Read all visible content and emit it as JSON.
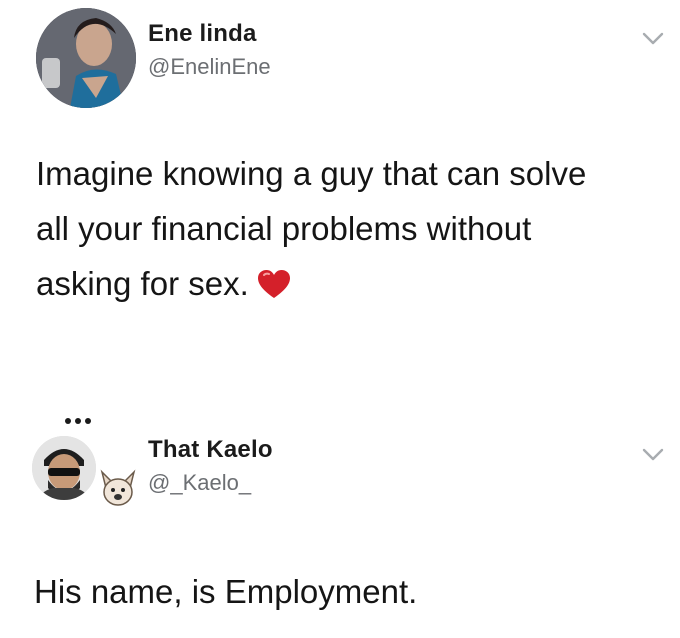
{
  "tweets": [
    {
      "author": {
        "name": "Ene linda",
        "handle": "@EnelinEne"
      },
      "text": "Imagine knowing a guy that can solve\nall your financial problems without\nasking for sex.",
      "emoji": "heart-emoji"
    },
    {
      "author": {
        "name": "That Kaelo",
        "handle": "@_Kaelo_"
      },
      "text": "His name, is Employment."
    }
  ],
  "icons": {
    "menu": "chevron-down-icon",
    "more": "more-dots-icon",
    "pet": "dog-emoji"
  },
  "colors": {
    "name": "#1b1b1b",
    "handle": "#6c6f73",
    "text": "#151515",
    "heart": "#d4202a",
    "chevron": "#a8acb0"
  }
}
